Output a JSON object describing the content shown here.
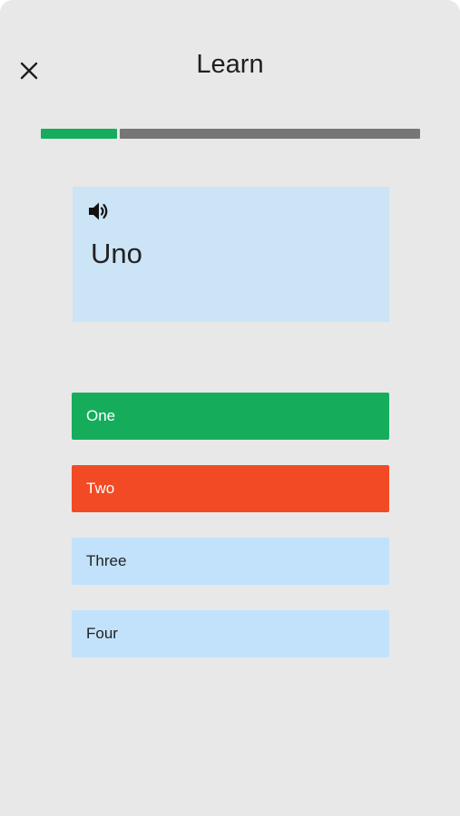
{
  "header": {
    "title": "Learn",
    "close_icon": "close-icon"
  },
  "progress": {
    "fraction_complete": 0.2,
    "done_color": "#15ad5c",
    "remaining_color": "#767676"
  },
  "prompt": {
    "speaker_icon": "speaker-icon",
    "word": "Uno",
    "card_color": "#cbe4f6"
  },
  "options": [
    {
      "label": "One",
      "state": "correct",
      "bg": "#15ad5c",
      "fg": "#ffffff"
    },
    {
      "label": "Two",
      "state": "incorrect",
      "bg": "#f24a24",
      "fg": "#ffffff"
    },
    {
      "label": "Three",
      "state": "neutral",
      "bg": "#c2e2fb",
      "fg": "#222222"
    },
    {
      "label": "Four",
      "state": "neutral",
      "bg": "#c2e2fb",
      "fg": "#222222"
    }
  ],
  "colors": {
    "background": "#e8e8e8"
  }
}
